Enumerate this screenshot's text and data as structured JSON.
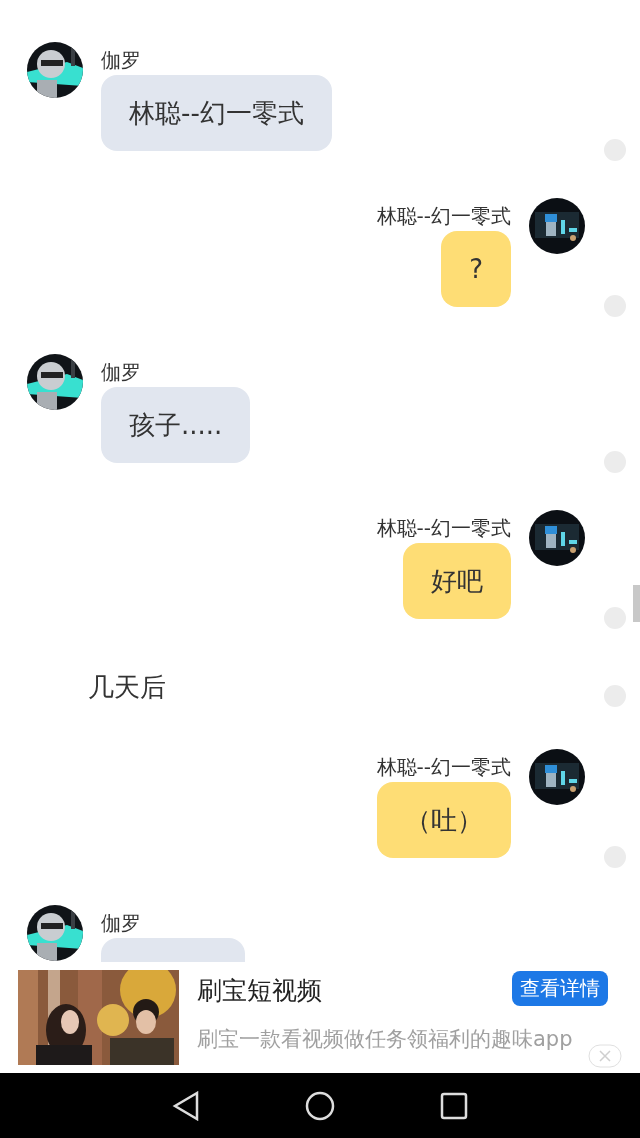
{
  "messages": [
    {
      "kind": "received",
      "sender": "伽罗",
      "text": "林聪--幻一零式"
    },
    {
      "kind": "sent",
      "sender": "林聪--幻一零式",
      "text": "?"
    },
    {
      "kind": "received",
      "sender": "伽罗",
      "text": "孩子....."
    },
    {
      "kind": "sent",
      "sender": "林聪--幻一零式",
      "text": "好吧"
    },
    {
      "kind": "narration",
      "text": "几天后"
    },
    {
      "kind": "sent",
      "sender": "林聪--幻一零式",
      "text": "（吐）"
    },
    {
      "kind": "received",
      "sender": "伽罗"
    }
  ],
  "ad": {
    "title": "刷宝短视频",
    "button": "查看详情",
    "description": "刷宝一款看视频做任务领福利的趣味app"
  }
}
